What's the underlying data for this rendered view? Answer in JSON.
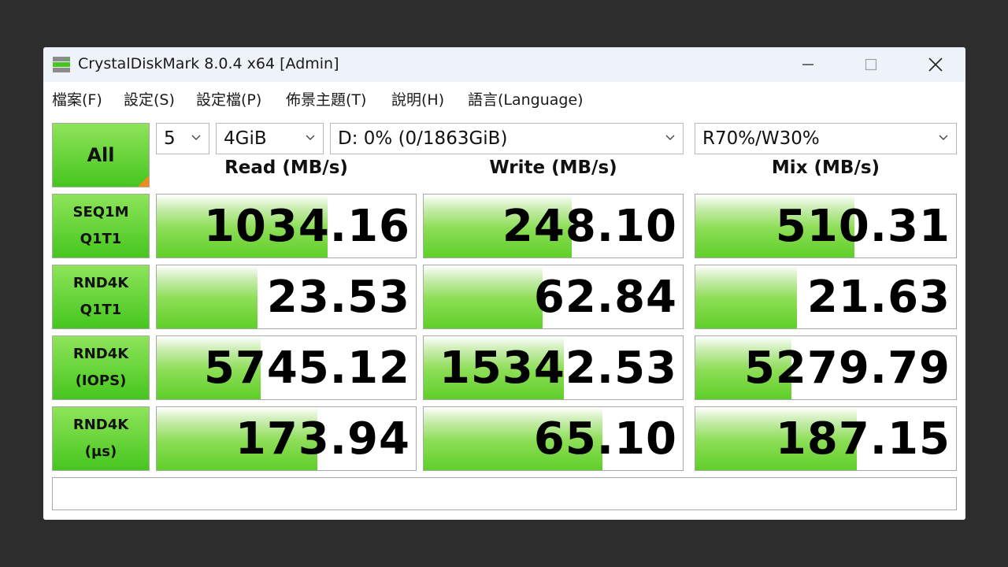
{
  "window": {
    "title": "CrystalDiskMark 8.0.4 x64 [Admin]"
  },
  "menu": [
    "檔案(F)",
    "設定(S)",
    "設定檔(P)",
    "佈景主題(T)",
    "說明(H)",
    "語言(Language)"
  ],
  "controls": {
    "all_label": "All",
    "count": "5",
    "size": "4GiB",
    "drive": "D: 0% (0/1863GiB)",
    "mix": "R70%/W30%"
  },
  "columns": [
    "Read (MB/s)",
    "Write (MB/s)",
    "Mix (MB/s)"
  ],
  "rows": [
    {
      "label1": "SEQ1M",
      "label2": "Q1T1",
      "values": [
        "1034.16",
        "248.10",
        "510.31"
      ],
      "fill": [
        0.66,
        0.57,
        0.61
      ]
    },
    {
      "label1": "RND4K",
      "label2": "Q1T1",
      "values": [
        "23.53",
        "62.84",
        "21.63"
      ],
      "fill": [
        0.39,
        0.46,
        0.39
      ]
    },
    {
      "label1": "RND4K",
      "label2": "(IOPS)",
      "values": [
        "5745.12",
        "15342.53",
        "5279.79"
      ],
      "fill": [
        0.4,
        0.54,
        0.37
      ]
    },
    {
      "label1": "RND4K",
      "label2": "(µs)",
      "values": [
        "173.94",
        "65.10",
        "187.15"
      ],
      "fill": [
        0.62,
        0.69,
        0.62
      ]
    }
  ],
  "status_text": "",
  "colors": {
    "accent_green": "#46c61e",
    "corner_orange": "#f08c1a"
  }
}
